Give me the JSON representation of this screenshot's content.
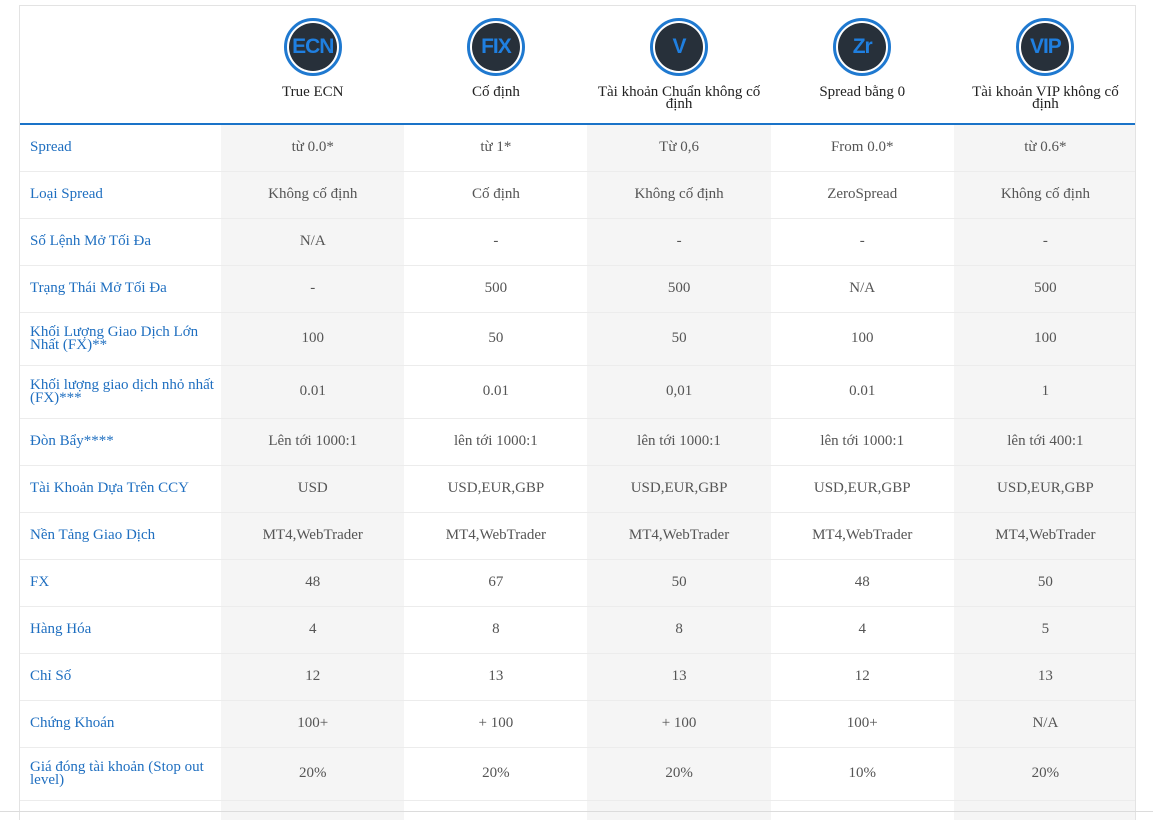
{
  "accounts": [
    {
      "badge": "ECN",
      "name": "True ECN"
    },
    {
      "badge": "FIX",
      "name": "Cố định"
    },
    {
      "badge": "V",
      "name": "Tài khoản Chuẩn không cố định"
    },
    {
      "badge": "Zr",
      "name": "Spread bằng 0"
    },
    {
      "badge": "VIP",
      "name": "Tài khoản VIP không cố định"
    }
  ],
  "rows": [
    {
      "label": "Spread",
      "values": [
        "từ 0.0*",
        "từ 1*",
        "Từ 0,6",
        "From 0.0*",
        "từ 0.6*"
      ]
    },
    {
      "label": "Loại Spread",
      "values": [
        "Không cố định",
        "Cố định",
        "Không cố định",
        "ZeroSpread",
        "Không cố định"
      ]
    },
    {
      "label": "Số Lệnh Mở Tối Đa",
      "values": [
        "N/A",
        "-",
        "-",
        "-",
        "-"
      ]
    },
    {
      "label": "Trạng Thái Mở Tối Đa",
      "values": [
        "-",
        "500",
        "500",
        "N/A",
        "500"
      ]
    },
    {
      "label": "Khối Lượng Giao Dịch Lớn Nhất (FX)**",
      "values": [
        "100",
        "50",
        "50",
        "100",
        "100"
      ]
    },
    {
      "label": "Khối lượng giao dịch nhỏ nhất (FX)***",
      "values": [
        "0.01",
        "0.01",
        "0,01",
        "0.01",
        "1"
      ]
    },
    {
      "label": "Đòn Bẩy****",
      "values": [
        "Lên tới 1000:1",
        "lên tới 1000:1",
        "lên tới 1000:1",
        "lên tới 1000:1",
        "lên tới 400:1"
      ]
    },
    {
      "label": "Tài Khoản Dựa Trên CCY",
      "values": [
        "USD",
        "USD,EUR,GBP",
        "USD,EUR,GBP",
        "USD,EUR,GBP",
        "USD,EUR,GBP"
      ]
    },
    {
      "label": "Nền Tảng Giao Dịch",
      "values": [
        "MT4,WebTrader",
        "MT4,WebTrader",
        "MT4,WebTrader",
        "MT4,WebTrader",
        "MT4,WebTrader"
      ]
    },
    {
      "label": "FX",
      "values": [
        "48",
        "67",
        "50",
        "48",
        "50"
      ]
    },
    {
      "label": "Hàng Hóa",
      "values": [
        "4",
        "8",
        "8",
        "4",
        "5"
      ]
    },
    {
      "label": "Chỉ Số",
      "values": [
        "12",
        "13",
        "13",
        "12",
        "13"
      ]
    },
    {
      "label": "Chứng Khoán",
      "values": [
        "100+",
        "+ 100",
        "+ 100",
        "100+",
        "N/A"
      ]
    },
    {
      "label": "Giá đóng tài khoản (Stop out level)",
      "values": [
        "20%",
        "20%",
        "20%",
        "10%",
        "20%"
      ]
    }
  ]
}
